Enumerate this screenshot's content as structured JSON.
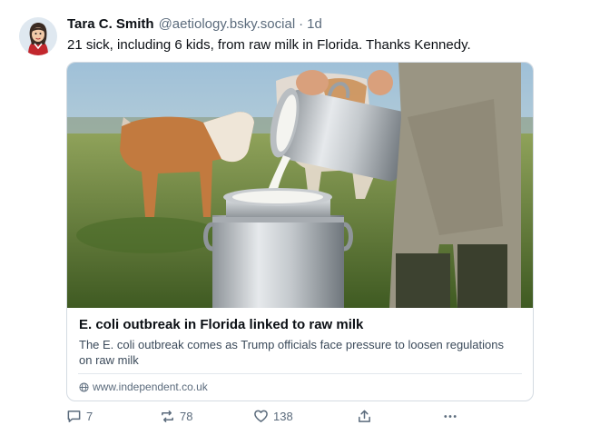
{
  "post": {
    "author": {
      "display_name": "Tara C. Smith",
      "handle": "@aetiology.bsky.social",
      "avatar_icon": "avatar-illustration"
    },
    "separator": "·",
    "time_ago": "1d",
    "text": "21 sick, including 6 kids, from raw milk in Florida. Thanks Kennedy.",
    "embed": {
      "image_icon": "raw-milk-pouring-photo",
      "title": "E. coli outbreak in Florida linked to raw milk",
      "description": "The E. coli outbreak comes as Trump officials face pressure to loosen regulations on raw milk",
      "domain": "www.independent.co.uk",
      "domain_icon": "globe-icon"
    },
    "actions": {
      "reply": {
        "icon": "reply-icon",
        "count": "7"
      },
      "repost": {
        "icon": "repost-icon",
        "count": "78"
      },
      "like": {
        "icon": "heart-icon",
        "count": "138"
      },
      "share": {
        "icon": "share-icon"
      },
      "more": {
        "icon": "more-icon"
      }
    }
  },
  "colors": {
    "text_primary": "#0b0f14",
    "text_secondary": "#5b6b7c",
    "border": "#d4dbe2"
  }
}
